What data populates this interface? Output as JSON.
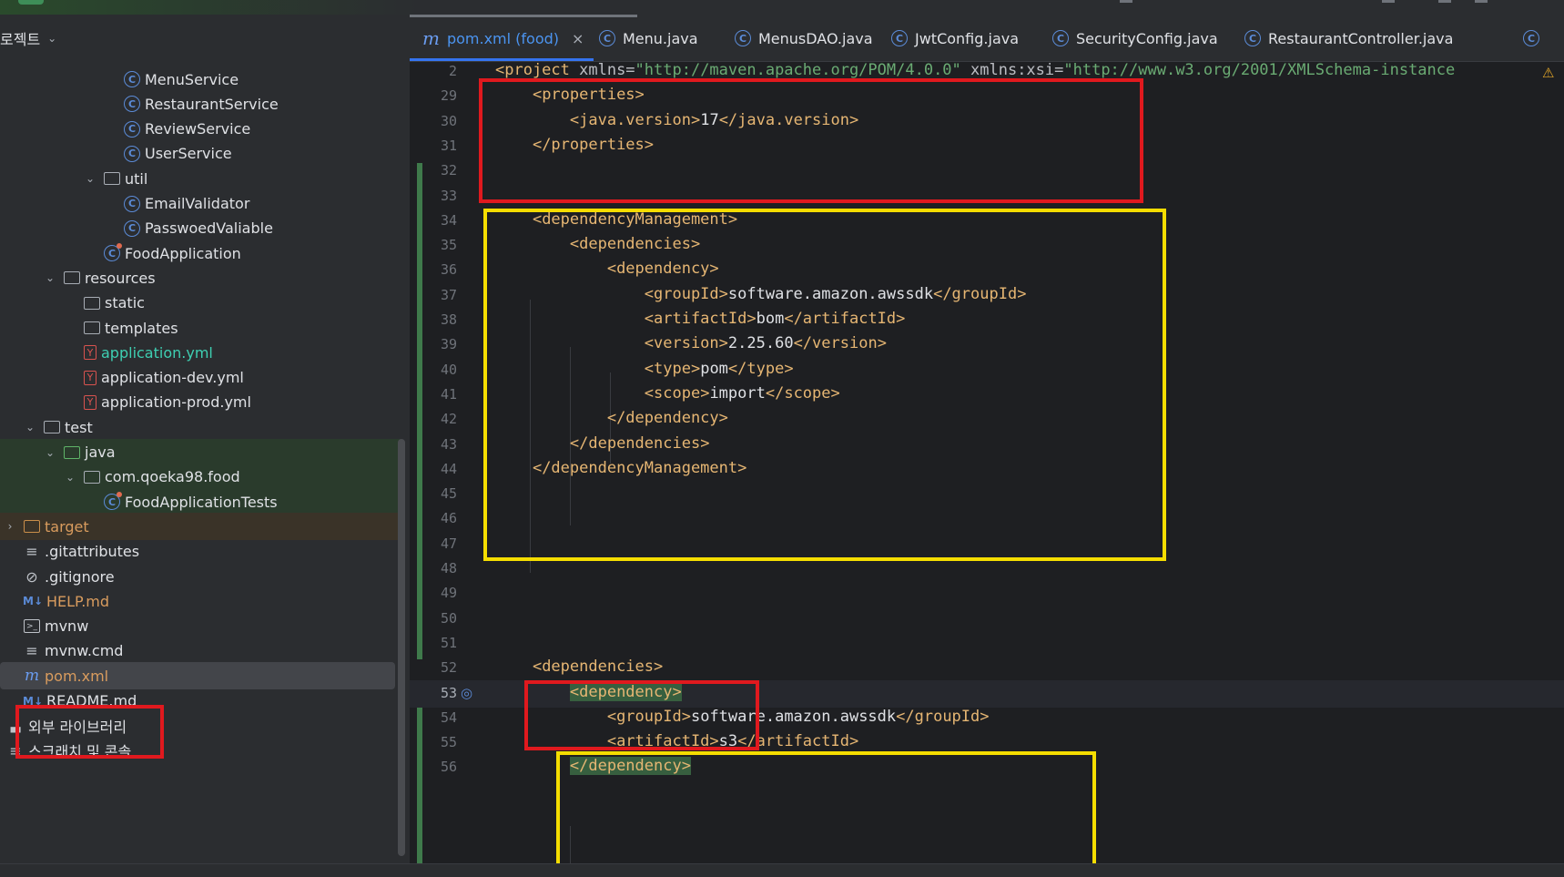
{
  "sidebar": {
    "header": {
      "title": "로젝트",
      "chevron": "chevron-down-icon"
    },
    "items": [
      {
        "label": "MenuService",
        "icon": "class-icon",
        "indent": 6
      },
      {
        "label": "RestaurantService",
        "icon": "class-icon",
        "indent": 6
      },
      {
        "label": "ReviewService",
        "icon": "class-icon",
        "indent": 6
      },
      {
        "label": "UserService",
        "icon": "class-icon",
        "indent": 6
      },
      {
        "label": "util",
        "icon": "package-folder-icon",
        "indent": 5,
        "expanded": true
      },
      {
        "label": "EmailValidator",
        "icon": "class-icon",
        "indent": 6
      },
      {
        "label": "PasswoedValiable",
        "icon": "class-icon",
        "indent": 6
      },
      {
        "label": "FoodApplication",
        "icon": "spring-app-class-icon",
        "indent": 5
      },
      {
        "label": "resources",
        "icon": "resources-folder-icon",
        "indent": 3,
        "expanded": true
      },
      {
        "label": "static",
        "icon": "folder-icon",
        "indent": 4
      },
      {
        "label": "templates",
        "icon": "folder-icon",
        "indent": 4
      },
      {
        "label": "application.yml",
        "icon": "yaml-icon",
        "indent": 4,
        "color": "teal"
      },
      {
        "label": "application-dev.yml",
        "icon": "yaml-icon",
        "indent": 4
      },
      {
        "label": "application-prod.yml",
        "icon": "yaml-icon",
        "indent": 4
      },
      {
        "label": "test",
        "icon": "folder-icon",
        "indent": 2,
        "expanded": true
      },
      {
        "label": "java",
        "icon": "test-folder-icon",
        "indent": 3,
        "expanded": true,
        "bg": "green"
      },
      {
        "label": "com.qoeka98.food",
        "icon": "package-folder-icon",
        "indent": 4,
        "expanded": true,
        "bg": "green"
      },
      {
        "label": "FoodApplicationTests",
        "icon": "spring-app-class-icon",
        "indent": 5,
        "bg": "green"
      },
      {
        "label": "target",
        "icon": "excluded-folder-icon",
        "indent": 1,
        "collapsed": true,
        "color": "orange",
        "bg": "brown"
      },
      {
        "label": ".gitattributes",
        "icon": "text-lines-icon",
        "indent": 1
      },
      {
        "label": ".gitignore",
        "icon": "ignore-icon",
        "indent": 1
      },
      {
        "label": "HELP.md",
        "icon": "markdown-icon",
        "indent": 1,
        "color": "orange"
      },
      {
        "label": "mvnw",
        "icon": "terminal-icon",
        "indent": 1
      },
      {
        "label": "mvnw.cmd",
        "icon": "text-lines-icon",
        "indent": 1
      },
      {
        "label": "pom.xml",
        "icon": "maven-icon",
        "indent": 1,
        "color": "orange",
        "selected": true
      },
      {
        "label": "README.md",
        "icon": "markdown-icon",
        "indent": 1
      },
      {
        "label": "외부 라이브러리",
        "icon": "library-icon",
        "indent": 0
      },
      {
        "label": "스크래치 및 콘솔",
        "icon": "scratch-icon",
        "indent": 0
      }
    ]
  },
  "tabs": [
    {
      "label": "pom.xml (food)",
      "icon": "maven-icon",
      "active": true,
      "close": "×"
    },
    {
      "label": "Menu.java",
      "icon": "class-icon"
    },
    {
      "label": "MenusDAO.java",
      "icon": "class-icon"
    },
    {
      "label": "JwtConfig.java",
      "icon": "class-icon"
    },
    {
      "label": "SecurityConfig.java",
      "icon": "class-icon"
    },
    {
      "label": "RestaurantController.java",
      "icon": "class-icon"
    }
  ],
  "editor": {
    "lines": [
      {
        "num": "2",
        "text": "<project xmlns=\"http://maven.apache.org/POM/4.0.0\" xmlns:xsi=\"http://www.w3.org/2001/XMLSchema-instance"
      },
      {
        "num": "29",
        "text": "    <properties>"
      },
      {
        "num": "30",
        "text": "        <java.version>17</java.version>"
      },
      {
        "num": "31",
        "text": "    </properties>"
      },
      {
        "num": "32",
        "text": ""
      },
      {
        "num": "33",
        "text": ""
      },
      {
        "num": "34",
        "text": "    <dependencyManagement>"
      },
      {
        "num": "35",
        "text": "        <dependencies>"
      },
      {
        "num": "36",
        "text": "            <dependency>"
      },
      {
        "num": "37",
        "text": "                <groupId>software.amazon.awssdk</groupId>"
      },
      {
        "num": "38",
        "text": "                <artifactId>bom</artifactId>"
      },
      {
        "num": "39",
        "text": "                <version>2.25.60</version>"
      },
      {
        "num": "40",
        "text": "                <type>pom</type>"
      },
      {
        "num": "41",
        "text": "                <scope>import</scope>"
      },
      {
        "num": "42",
        "text": "            </dependency>"
      },
      {
        "num": "43",
        "text": "        </dependencies>"
      },
      {
        "num": "44",
        "text": "    </dependencyManagement>"
      },
      {
        "num": "45",
        "text": ""
      },
      {
        "num": "46",
        "text": ""
      },
      {
        "num": "47",
        "text": ""
      },
      {
        "num": "48",
        "text": ""
      },
      {
        "num": "49",
        "text": ""
      },
      {
        "num": "50",
        "text": ""
      },
      {
        "num": "51",
        "text": ""
      },
      {
        "num": "52",
        "text": "    <dependencies>"
      },
      {
        "num": "53",
        "text": "        <dependency>",
        "current": true,
        "highlight": true
      },
      {
        "num": "54",
        "text": "            <groupId>software.amazon.awssdk</groupId>"
      },
      {
        "num": "55",
        "text": "            <artifactId>s3</artifactId>"
      },
      {
        "num": "56",
        "text": "        </dependency>",
        "highlight": true
      }
    ],
    "warning_icon": "warning-triangle-icon",
    "gutter_icon": "override-arrow-icon"
  },
  "colors": {
    "annotation_red": "#e0191e",
    "annotation_yellow": "#f5dd00",
    "tag": "#e6b673",
    "string": "#6aab73",
    "accent": "#3574f0"
  }
}
